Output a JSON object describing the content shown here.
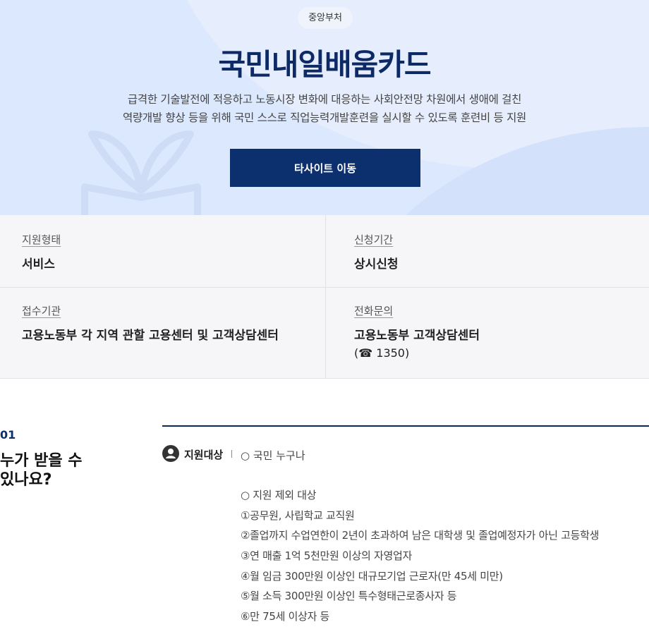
{
  "hero": {
    "badge": "중앙부처",
    "title": "국민내일배움카드",
    "desc_lines": [
      "급격한 기술발전에 적응하고 노동시장 변화에 대응하는 사회안전망 차원에서 생애에 걸친",
      "역량개발 향상 등을 위해 국민 스스로 직업능력개발훈련을 실시할 수 있도록 훈련비 등 지원"
    ],
    "button_label": "타사이트 이동"
  },
  "info": {
    "support_type": {
      "label": "지원형태",
      "value": "서비스"
    },
    "apply_period": {
      "label": "신청기간",
      "value": "상시신청"
    },
    "agency": {
      "label": "접수기관",
      "value": "고용노동부 각 지역 관할 고용센터 및 고객상담센터"
    },
    "contact": {
      "label": "전화문의",
      "value": "고용노동부 고객상담센터",
      "phone": "(☎ 1350)"
    }
  },
  "section": {
    "number": "01",
    "title_lines": [
      "누가 받을 수",
      "있나요?"
    ],
    "target_label": "지원대상",
    "target_first": "○ 국민 누구나",
    "exclusions": [
      "○ 지원 제외 대상",
      "①공무원, 사립학교 교직원",
      "②졸업까지 수업연한이 2년이 초과하여 남은 대학생 및 졸업예정자가 아닌 고등학생",
      "③연 매출 1억 5천만원 이상의 자영업자",
      "④월 임금 300만원 이상인 대규모기업 근로자(만 45세 미만)",
      "⑤월 소득 300만원 이상인 특수형태근로종사자 등",
      "⑥만 75세 이상자 등"
    ]
  },
  "colors": {
    "primary": "#0c2f6e",
    "hero_bg": "#dce8fd",
    "info_bg": "#f6f6f8"
  },
  "icons": [
    "book-plant-icon",
    "person-icon"
  ]
}
